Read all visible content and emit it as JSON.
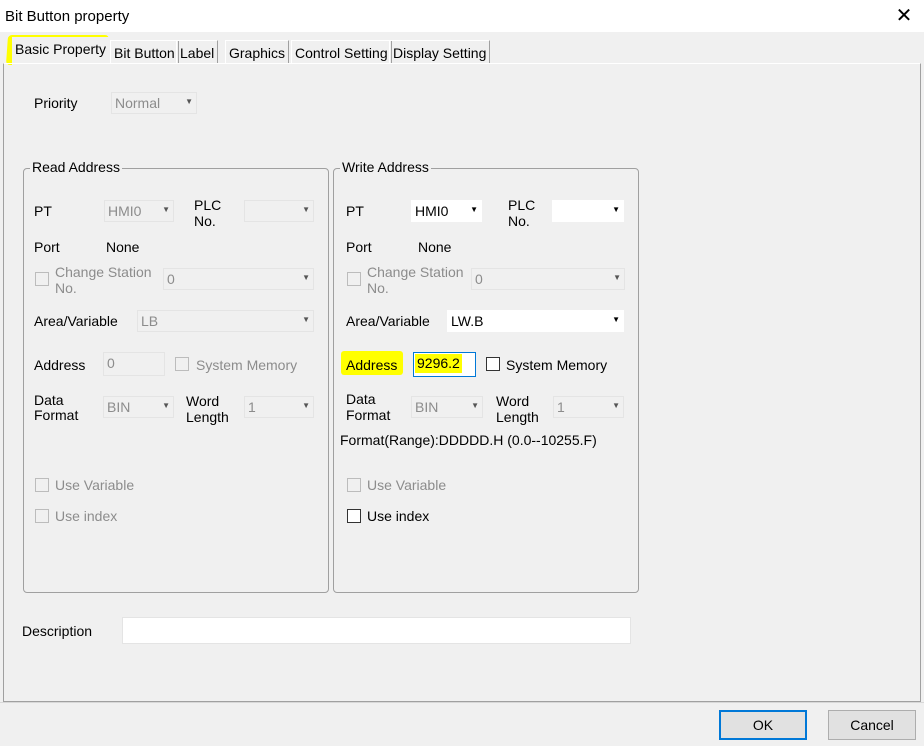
{
  "window": {
    "title": "Bit Button property",
    "close_glyph": "✕"
  },
  "tabs": [
    {
      "label": "Basic Property",
      "active": true
    },
    {
      "label": "Bit Button"
    },
    {
      "label": "Label"
    },
    {
      "label": "Graphics"
    },
    {
      "label": "Control Setting"
    },
    {
      "label": "Display Setting"
    }
  ],
  "priority": {
    "label": "Priority",
    "value": "Normal"
  },
  "read_address": {
    "title": "Read Address",
    "pt_label": "PT",
    "pt_value": "HMI0",
    "plc_no_label_1": "PLC",
    "plc_no_label_2": "No.",
    "plc_no_value": "",
    "port_label": "Port",
    "port_value": "None",
    "change_station_label_1": "Change Station",
    "change_station_label_2": "No.",
    "change_station_value": "0",
    "area_label": "Area/Variable",
    "area_value": "LB",
    "address_label": "Address",
    "address_value": "0",
    "system_memory_label": "System Memory",
    "data_format_label_1": "Data",
    "data_format_label_2": "Format",
    "data_format_value": "BIN",
    "word_length_label_1": "Word",
    "word_length_label_2": "Length",
    "word_length_value": "1",
    "use_variable_label": "Use Variable",
    "use_index_label": "Use index"
  },
  "write_address": {
    "title": "Write Address",
    "pt_label": "PT",
    "pt_value": "HMI0",
    "plc_no_label_1": "PLC",
    "plc_no_label_2": "No.",
    "plc_no_value": "",
    "port_label": "Port",
    "port_value": "None",
    "change_station_label_1": "Change Station",
    "change_station_label_2": "No.",
    "change_station_value": "0",
    "area_label": "Area/Variable",
    "area_value": "LW.B",
    "address_label": "Address",
    "address_value": "9296.2",
    "system_memory_label": "System Memory",
    "data_format_label_1": "Data",
    "data_format_label_2": "Format",
    "data_format_value": "BIN",
    "word_length_label_1": "Word",
    "word_length_label_2": "Length",
    "word_length_value": "1",
    "format_range": "Format(Range):DDDDD.H (0.0--10255.F)",
    "use_variable_label": "Use Variable",
    "use_index_label": "Use index"
  },
  "description": {
    "label": "Description",
    "value": ""
  },
  "buttons": {
    "ok": "OK",
    "cancel": "Cancel"
  },
  "colors": {
    "highlight": "#ffff00",
    "focus_border": "#0078d7",
    "disabled_text": "#8c8c8c"
  },
  "icons": {
    "caret": "dropdown-arrow-icon"
  }
}
